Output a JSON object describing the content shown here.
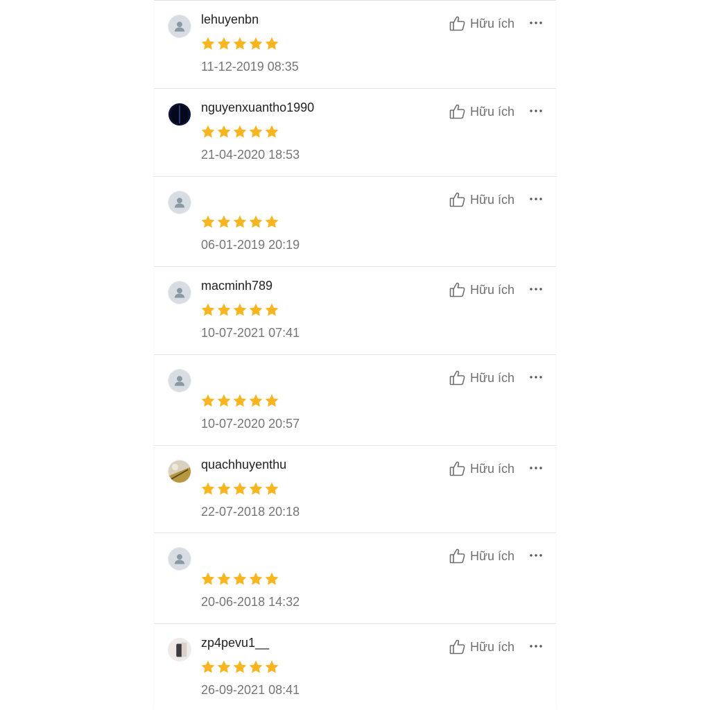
{
  "colors": {
    "star": "#f7b520",
    "divider": "#e4e4e4",
    "username": "#222222",
    "date": "#757575",
    "helpful_text": "#707070",
    "default_avatar_bg": "#d7dde2",
    "default_avatar_fg": "#8a98a3"
  },
  "icons": {
    "helpful": "thumbs-up-outline-icon",
    "more": "ellipsis-horizontal-icon",
    "rating": "star-filled-icon",
    "default_avatar": "person-silhouette-icon"
  },
  "reviews": [
    {
      "username": "lehuyenbn",
      "rating": 5,
      "date": "11-12-2019 08:35",
      "helpful_label": "Hữu ích",
      "avatar": "default"
    },
    {
      "username": "nguyenxuantho1990",
      "rating": 5,
      "date": "21-04-2020 18:53",
      "helpful_label": "Hữu ích",
      "avatar": "photo-dark"
    },
    {
      "username": "",
      "rating": 5,
      "date": "06-01-2019 20:19",
      "helpful_label": "Hữu ích",
      "avatar": "default"
    },
    {
      "username": "macminh789",
      "rating": 5,
      "date": "10-07-2021 07:41",
      "helpful_label": "Hữu ích",
      "avatar": "default"
    },
    {
      "username": "",
      "rating": 5,
      "date": "10-07-2020 20:57",
      "helpful_label": "Hữu ích",
      "avatar": "default"
    },
    {
      "username": "quachhuyenthu",
      "rating": 5,
      "date": "22-07-2018 20:18",
      "helpful_label": "Hữu ích",
      "avatar": "photo-gold"
    },
    {
      "username": "",
      "rating": 5,
      "date": "20-06-2018 14:32",
      "helpful_label": "Hữu ích",
      "avatar": "default"
    },
    {
      "username": "zp4pevu1__",
      "rating": 5,
      "date": "26-09-2021 08:41",
      "helpful_label": "Hữu ích",
      "avatar": "photo-light"
    }
  ]
}
